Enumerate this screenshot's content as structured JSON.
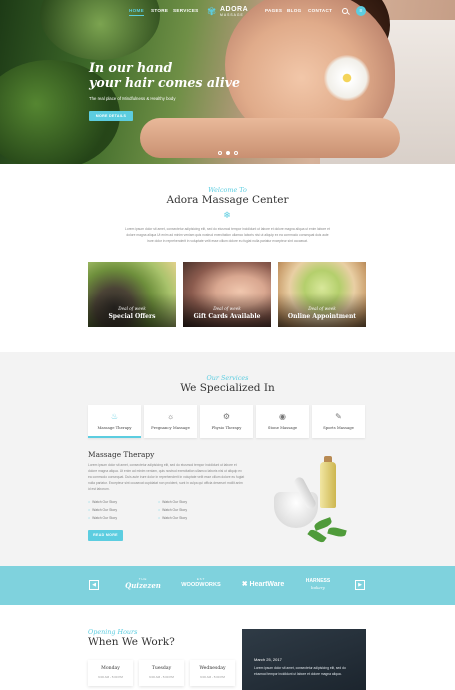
{
  "nav": {
    "items": [
      {
        "label": "HOME",
        "active": true
      },
      {
        "label": "STORE",
        "active": false
      },
      {
        "label": "SERVICES",
        "active": false
      },
      {
        "label": "PAGES",
        "active": false
      },
      {
        "label": "BLOG",
        "active": false
      },
      {
        "label": "CONTACT",
        "active": false
      }
    ],
    "logo_name": "ADORA",
    "logo_sub": "MASSAGE",
    "icons": [
      "search-icon",
      "menu-icon"
    ]
  },
  "hero": {
    "title_line1": "In our hand",
    "title_line2": "your hair comes alive",
    "subtitle": "The real place of Mindfulness & Healthy body",
    "button": "MORE DETAILS"
  },
  "welcome": {
    "kicker": "Welcome To",
    "title": "Adora Massage Center",
    "body": "Lorem ipsum dolor sit amet, consectetur adipisicing elit, sed do eiusmod tempor incididunt ut labore et dolore magna aliqua ut enim labore et dolore magna aliqua Ut enim ad minim veniam quis nostrud exercitation ullamco laboris nisi ut aliquip ex ea commodo consequat duis aute irure dolor in reprehenderit in voluptate velit esse cillum dolore eu fugiat nulla pariatur excepteur sint occaecat."
  },
  "promos": [
    {
      "kicker": "Deal of week",
      "title": "Special Offers",
      "color": "#5d7a3a"
    },
    {
      "kicker": "Deal of week",
      "title": "Gift Cards Available",
      "color": "#8a6e62"
    },
    {
      "kicker": "Deal of week",
      "title": "Online Appointment",
      "color": "#b7c56a"
    }
  ],
  "services": {
    "kicker": "Our Services",
    "title": "We Specialized In",
    "tabs": [
      {
        "label": "Massage Therapy",
        "icon": "massage-icon",
        "active": true
      },
      {
        "label": "Pregnancy Massage",
        "icon": "pregnancy-icon",
        "active": false
      },
      {
        "label": "Physio Therapy",
        "icon": "physio-icon",
        "active": false
      },
      {
        "label": "Stone Massage",
        "icon": "stone-icon",
        "active": false
      },
      {
        "label": "Sports Massage",
        "icon": "sports-icon",
        "active": false
      }
    ],
    "detail_title": "Massage Therapy",
    "detail_body": "Lorem ipsum dolor sit amet, consectetur adipisicing elit, sed do eiusmod tempor incididunt ut labore et dolore magna aliqua. Ut enim ad minim veniam, quis nostrud exercitation ullamco laboris nisi ut aliquip ex ea commodo consequat. Duis aute irure dolor in reprehenderit in voluptate velit esse cillum dolore eu fugiat nulla pariatur. Excepteur sint occaecat cupidatat non proident, sunt in culpa qui officia deserunt mollit anim id est laborum.",
    "list_left": [
      "Watch Our Story",
      "Watch Our Story",
      "Watch Our Story"
    ],
    "list_right": [
      "Watch Our Story",
      "Watch Our Story",
      "Watch Our Story"
    ],
    "button": "READ MORE"
  },
  "partners": {
    "brands": [
      {
        "main": "Quizezen",
        "sub": "THE"
      },
      {
        "main": "WOODWORKS",
        "sub": "EST"
      },
      {
        "main": "HeartWare",
        "sub": ""
      },
      {
        "main": "HARNESS",
        "sub": "bakery"
      }
    ]
  },
  "hours": {
    "kicker": "Opening Hours",
    "title": "When We Work?",
    "days": [
      {
        "name": "Monday",
        "time": "9:00 AM - 5:00 PM"
      },
      {
        "name": "Tuesday",
        "time": "9:00 AM - 5:00 PM"
      },
      {
        "name": "Wednesday",
        "time": "9:00 AM - 5:00 PM"
      }
    ]
  },
  "news": {
    "date": "March 25, 2017",
    "body": "Lorem ipsum dolor sit amet, consectetur adipisicing elit, sed do eiusmod tempor incididunt ut labore et dolore magna aliqua."
  }
}
